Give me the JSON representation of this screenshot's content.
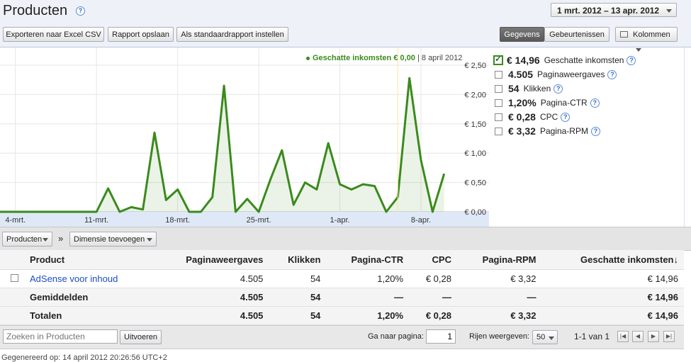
{
  "header": {
    "title": "Producten",
    "help": "?",
    "date_range": "1 mrt. 2012 – 13 apr. 2012",
    "toolbar": {
      "export": "Exporteren naar Excel CSV",
      "save": "Rapport opslaan",
      "default": "Als standaardrapport instellen"
    },
    "view_toggle": [
      "Gegevens",
      "Gebeurtenissen"
    ],
    "columns": "Kolommen"
  },
  "chart_data": {
    "type": "area",
    "tooltip": {
      "label": "Geschatte inkomsten € 0,00",
      "date": "8 april 2012"
    },
    "x_ticks": [
      "4-mrt.",
      "11-mrt.",
      "18-mrt.",
      "25-mrt.",
      "1-apr.",
      "8-apr."
    ],
    "y_ticks": [
      "€ 0,00",
      "€ 0,50",
      "€ 1,00",
      "€ 1,50",
      "€ 2,00",
      "€ 2,50"
    ],
    "ylim": [
      0,
      2.5
    ],
    "series": [
      {
        "color": "#3a8a1c",
        "values": [
          0,
          0,
          0,
          0,
          0,
          0,
          0,
          0,
          0,
          0,
          0,
          0,
          0,
          0.4,
          0,
          0.08,
          0.04,
          1.35,
          0.2,
          0.38,
          0,
          0,
          0.25,
          2.15,
          0,
          0.22,
          0,
          0.55,
          1.05,
          0.12,
          0.5,
          0.38,
          1.17,
          0.47,
          0.38,
          0.47,
          0.44,
          0,
          0.25,
          2.28,
          0.88,
          0,
          0.65
        ]
      }
    ]
  },
  "metrics": [
    {
      "value": "€ 14,96",
      "label": "Geschatte inkomsten",
      "checked": true
    },
    {
      "value": "4.505",
      "label": "Paginaweergaves",
      "checked": false
    },
    {
      "value": "54",
      "label": "Klikken",
      "checked": false
    },
    {
      "value": "1,20%",
      "label": "Pagina-CTR",
      "checked": false
    },
    {
      "value": "€ 0,28",
      "label": "CPC",
      "checked": false
    },
    {
      "value": "€ 3,32",
      "label": "Pagina-RPM",
      "checked": false
    }
  ],
  "dimension_bar": {
    "dimension": "Producten",
    "arrow": "»",
    "add": "Dimensie toevoegen"
  },
  "table": {
    "headers": [
      "Product",
      "Paginaweergaves",
      "Klikken",
      "Pagina-CTR",
      "CPC",
      "Pagina-RPM",
      "Geschatte inkomsten"
    ],
    "sort_arrow": "↓",
    "rows": [
      [
        "AdSense voor inhoud",
        "4.505",
        "54",
        "1,20%",
        "€ 0,28",
        "€ 3,32",
        "€ 14,96"
      ]
    ],
    "averages": [
      "Gemiddelden",
      "4.505",
      "54",
      "—",
      "—",
      "—",
      "€ 14,96"
    ],
    "totals": [
      "Totalen",
      "4.505",
      "54",
      "1,20%",
      "€ 0,28",
      "€ 3,32",
      "€ 14,96"
    ]
  },
  "footer": {
    "search_placeholder": "Zoeken in Producten",
    "search_button": "Uitvoeren",
    "goto_label": "Ga naar pagina:",
    "goto_value": "1",
    "rows_label": "Rijen weergeven:",
    "rows_value": "50",
    "range": "1-1 van 1"
  },
  "generated": "Gegenereerd op: 14 april 2012 20:26:56 UTC+2"
}
